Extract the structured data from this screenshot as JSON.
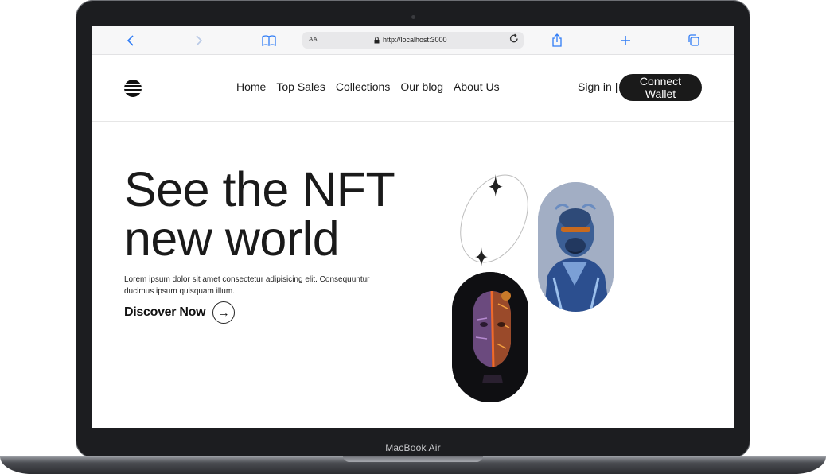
{
  "device": {
    "model_label": "MacBook Air"
  },
  "browser": {
    "text_size_label": "AA",
    "url": "http://localhost:3000",
    "icons": {
      "back": "chevron-left-icon",
      "forward": "chevron-right-icon",
      "bookmarks": "book-icon",
      "lock": "lock-icon",
      "reload": "reload-icon",
      "share": "share-icon",
      "new_tab": "plus-icon",
      "tabs": "tabs-icon"
    }
  },
  "nav": {
    "links": [
      "Home",
      "Top Sales",
      "Collections",
      "Our blog",
      "About Us"
    ],
    "sign_in": "Sign in |",
    "connect_wallet": "Connect Wallet"
  },
  "hero": {
    "title_line1": "See the NFT",
    "title_line2": "new world",
    "description": "Lorem ipsum dolor sit amet consectetur adipisicing elit. Consequuntur ducimus ipsum quisquam illum.",
    "cta_label": "Discover Now",
    "cta_icon": "→"
  },
  "colors": {
    "accent": "#2f7cf6",
    "dark": "#1a1a1a",
    "gorilla_bg": "#a2aec4"
  }
}
